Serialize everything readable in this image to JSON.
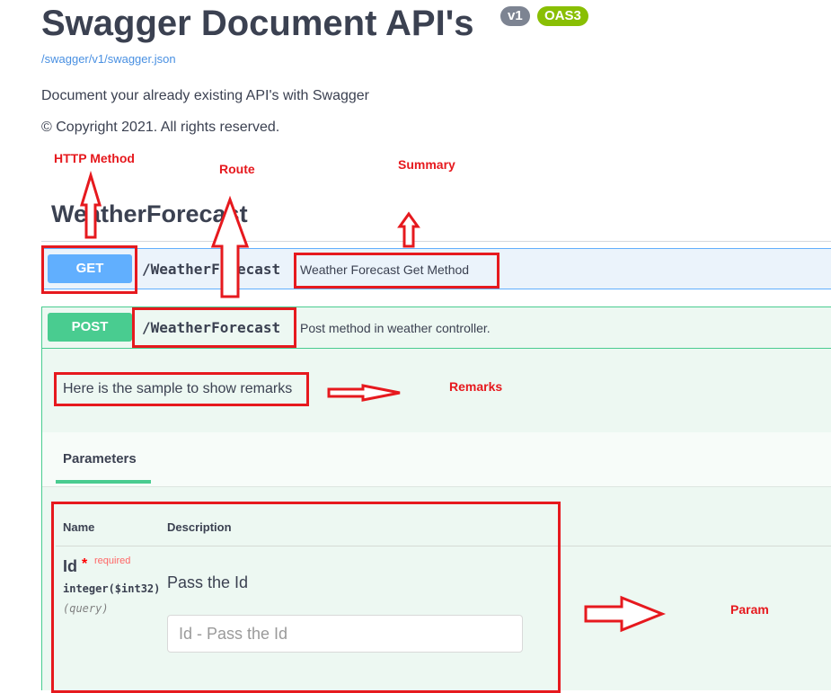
{
  "header": {
    "title": "Swagger Document API's",
    "version_badge": "v1",
    "oas_badge": "OAS3",
    "spec_link": "/swagger/v1/swagger.json",
    "description": "Document your already existing API's with Swagger",
    "copyright": "© Copyright 2021. All rights reserved."
  },
  "tag": {
    "name": "WeatherForecast"
  },
  "get_op": {
    "method": "GET",
    "path": "/WeatherForecast",
    "summary": "Weather Forecast Get Method"
  },
  "post_op": {
    "method": "POST",
    "path": "/WeatherForecast",
    "summary": "Post method in weather controller.",
    "remarks": "Here is the sample to show remarks",
    "parameters_tab": "Parameters",
    "columns": {
      "name": "Name",
      "description": "Description"
    },
    "param": {
      "name": "Id",
      "required_star": "*",
      "required_label": "required",
      "type": "integer($int32)",
      "location": "(query)",
      "description": "Pass the Id",
      "placeholder": "Id - Pass the Id"
    }
  },
  "annotations": {
    "http_method": "HTTP Method",
    "route": "Route",
    "summary": "Summary",
    "remarks": "Remarks",
    "param": "Param"
  },
  "colors": {
    "get": "#61affe",
    "post": "#49cc90",
    "annotation": "#e6191e",
    "link": "#4990e2"
  }
}
